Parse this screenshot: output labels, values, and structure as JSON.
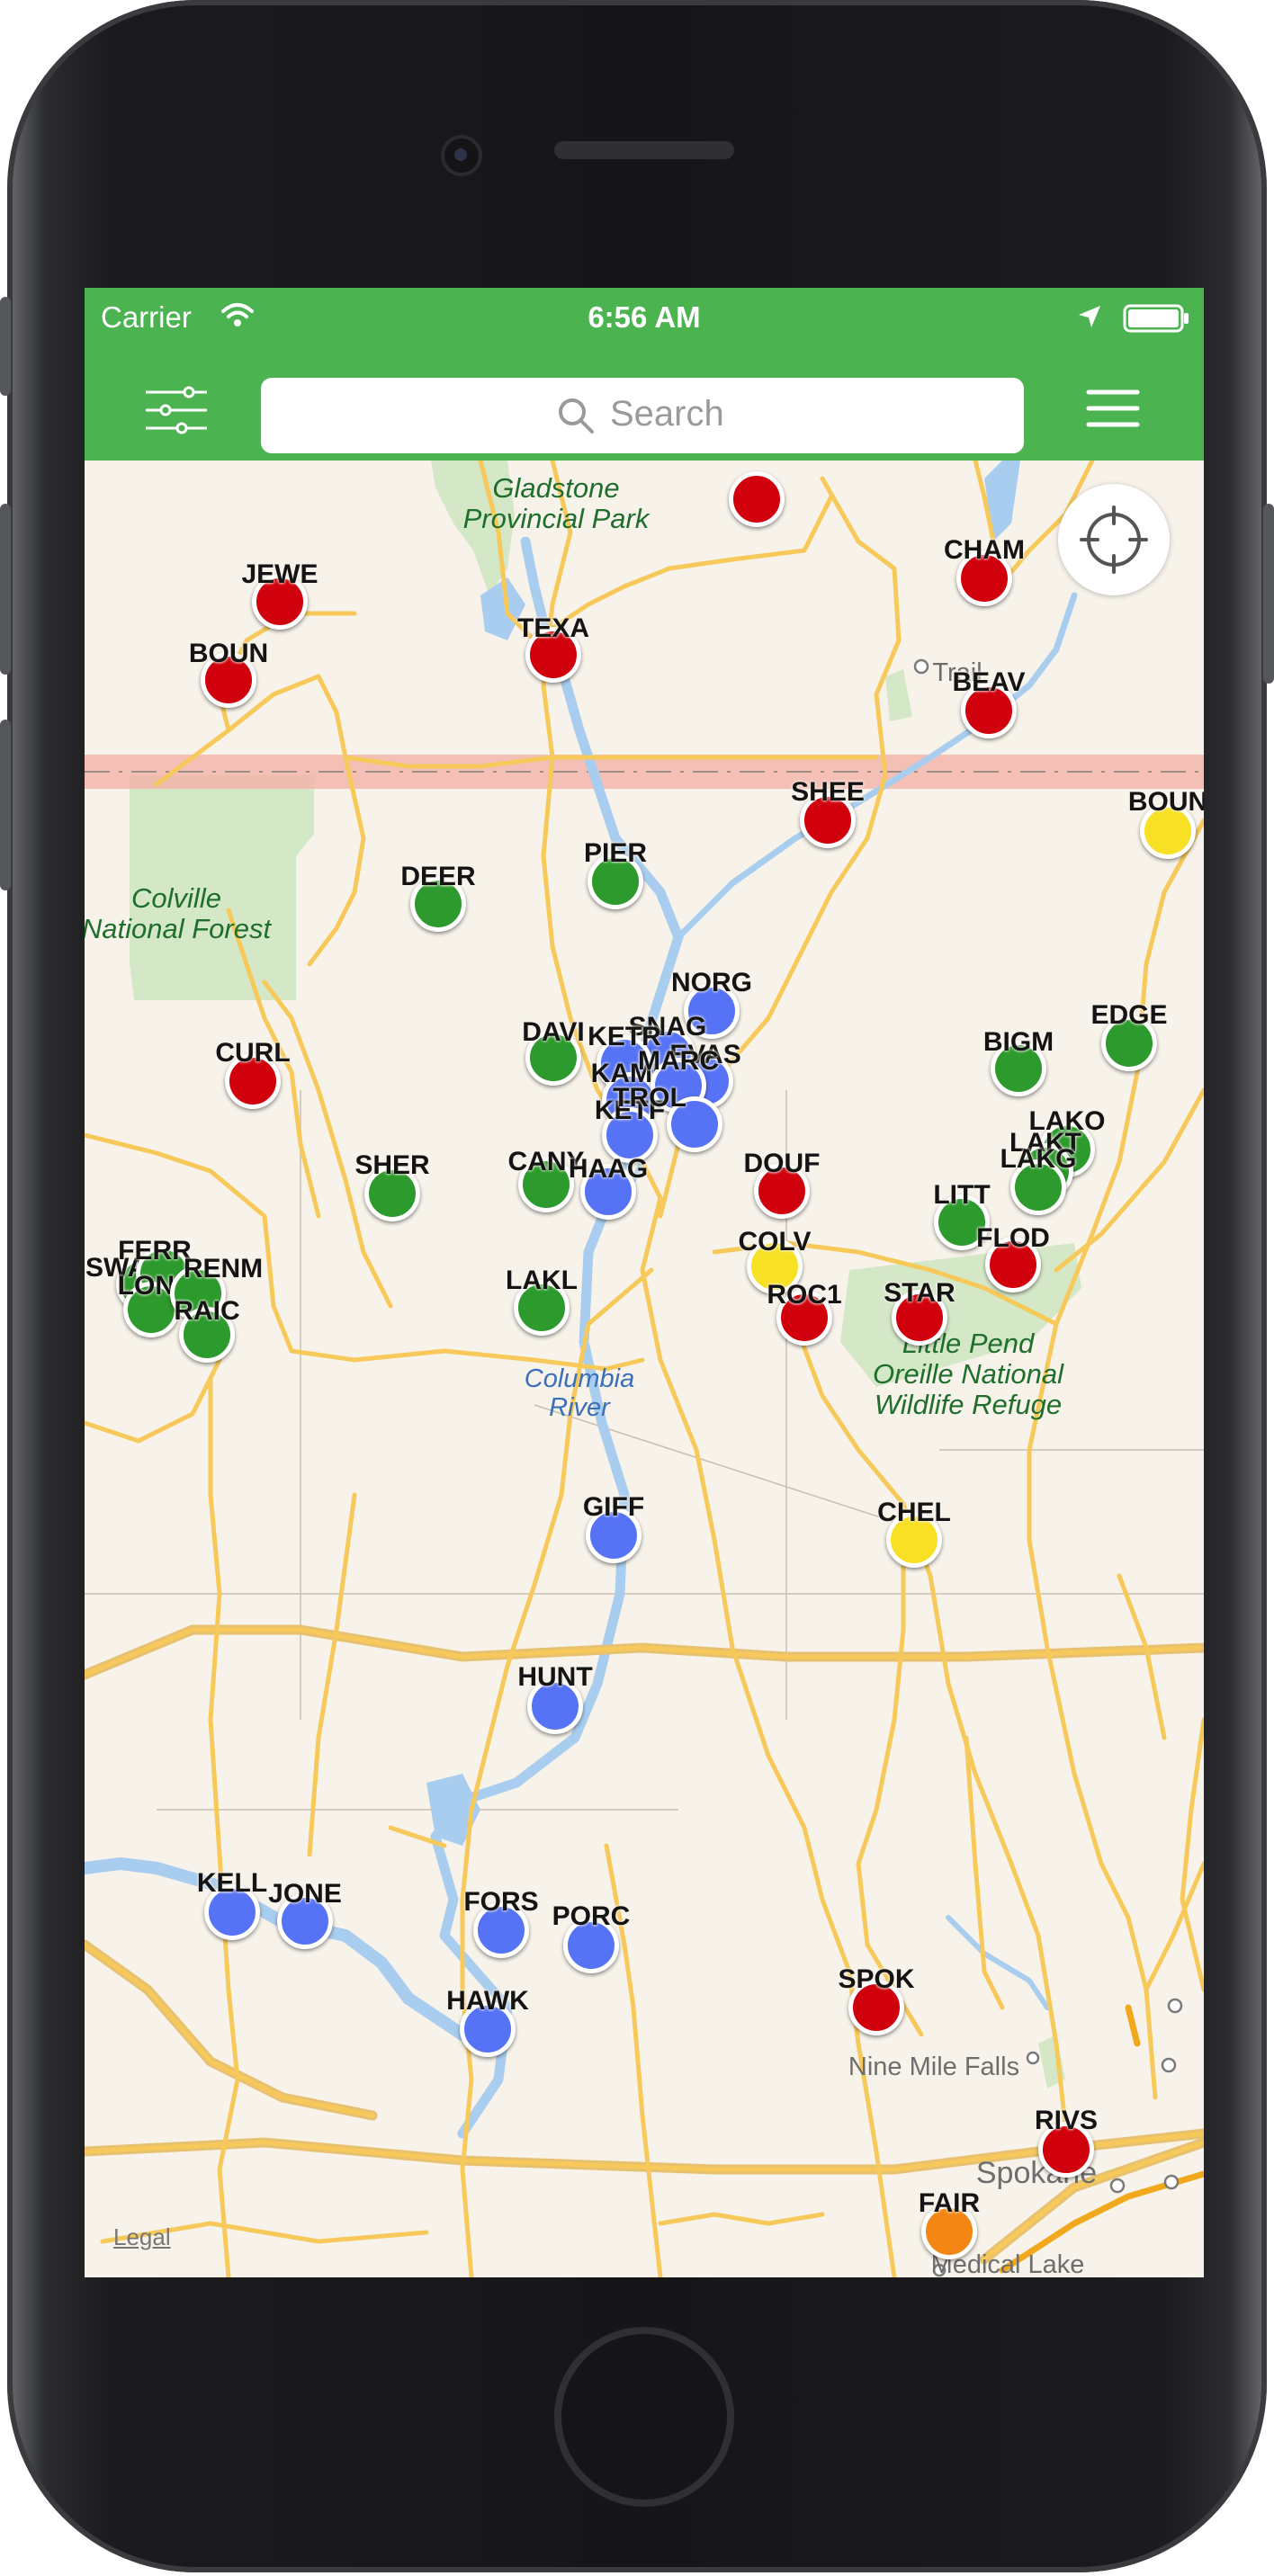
{
  "status_bar": {
    "carrier": "Carrier",
    "time": "6:56 AM"
  },
  "search": {
    "placeholder": "Search"
  },
  "map": {
    "legal": "Legal",
    "colors": {
      "red": "#d0000c",
      "green": "#2c9a2c",
      "blue": "#5773f5",
      "yellow": "#f8e024",
      "orange": "#f48714"
    },
    "place_labels": [
      {
        "name": "park1",
        "text": "Gladstone\nProvincial Park",
        "kind": "park"
      },
      {
        "name": "forest",
        "text": "Colville\nNational Forest",
        "kind": "park"
      },
      {
        "name": "river",
        "text": "Columbia\nRiver",
        "kind": "water"
      },
      {
        "name": "refuge",
        "text": "Little Pend\nOreille National\nWildlife Refuge",
        "kind": "park"
      },
      {
        "name": "trail",
        "text": "Trail",
        "kind": "town"
      },
      {
        "name": "ninemile",
        "text": "Nine Mile Falls",
        "kind": "town"
      },
      {
        "name": "spokane",
        "text": "Spokane",
        "kind": "town"
      },
      {
        "name": "medical",
        "text": "Medical Lake",
        "kind": "town"
      }
    ],
    "stations": [
      {
        "code": "",
        "color": "red"
      },
      {
        "code": "JEWE",
        "color": "red"
      },
      {
        "code": "BOUN",
        "color": "red"
      },
      {
        "code": "TEXA",
        "color": "red"
      },
      {
        "code": "CHAM",
        "color": "red"
      },
      {
        "code": "BEAV",
        "color": "red"
      },
      {
        "code": "SHEE",
        "color": "red"
      },
      {
        "code": "BOUN",
        "color": "yellow"
      },
      {
        "code": "PIER",
        "color": "green"
      },
      {
        "code": "DEER",
        "color": "green"
      },
      {
        "code": "CURL",
        "color": "red"
      },
      {
        "code": "DAVI",
        "color": "green"
      },
      {
        "code": "NORG",
        "color": "blue"
      },
      {
        "code": "SNAG",
        "color": "blue"
      },
      {
        "code": "KETR",
        "color": "blue"
      },
      {
        "code": "EVAS",
        "color": "blue"
      },
      {
        "code": "KAML",
        "color": "blue"
      },
      {
        "code": "MARC",
        "color": "blue"
      },
      {
        "code": "KETF",
        "color": "blue"
      },
      {
        "code": "TROL",
        "color": "blue"
      },
      {
        "code": "BIGM",
        "color": "green"
      },
      {
        "code": "EDGE",
        "color": "green"
      },
      {
        "code": "LAKO",
        "color": "green"
      },
      {
        "code": "LAKT",
        "color": "green"
      },
      {
        "code": "LAKG",
        "color": "green"
      },
      {
        "code": "LITT",
        "color": "green"
      },
      {
        "code": "FLOD",
        "color": "red"
      },
      {
        "code": "SHER",
        "color": "green"
      },
      {
        "code": "CANY",
        "color": "green"
      },
      {
        "code": "HAAG",
        "color": "blue"
      },
      {
        "code": "DOUF",
        "color": "red"
      },
      {
        "code": "COLV",
        "color": "yellow"
      },
      {
        "code": "ROC1",
        "color": "red"
      },
      {
        "code": "STAR",
        "color": "red"
      },
      {
        "code": "LAKL",
        "color": "green"
      },
      {
        "code": "SWAN",
        "color": "green"
      },
      {
        "code": "FERR",
        "color": "green"
      },
      {
        "code": "LONG",
        "color": "green"
      },
      {
        "code": "RENM",
        "color": "green"
      },
      {
        "code": "RAIC",
        "color": "green"
      },
      {
        "code": "GIFF",
        "color": "blue"
      },
      {
        "code": "CHEL",
        "color": "yellow"
      },
      {
        "code": "HUNT",
        "color": "blue"
      },
      {
        "code": "KELL",
        "color": "blue"
      },
      {
        "code": "JONE",
        "color": "blue"
      },
      {
        "code": "FORS",
        "color": "blue"
      },
      {
        "code": "PORC",
        "color": "blue"
      },
      {
        "code": "HAWK",
        "color": "blue"
      },
      {
        "code": "SPOK",
        "color": "red"
      },
      {
        "code": "RIVS",
        "color": "red"
      },
      {
        "code": "FAIR",
        "color": "orange"
      }
    ]
  }
}
